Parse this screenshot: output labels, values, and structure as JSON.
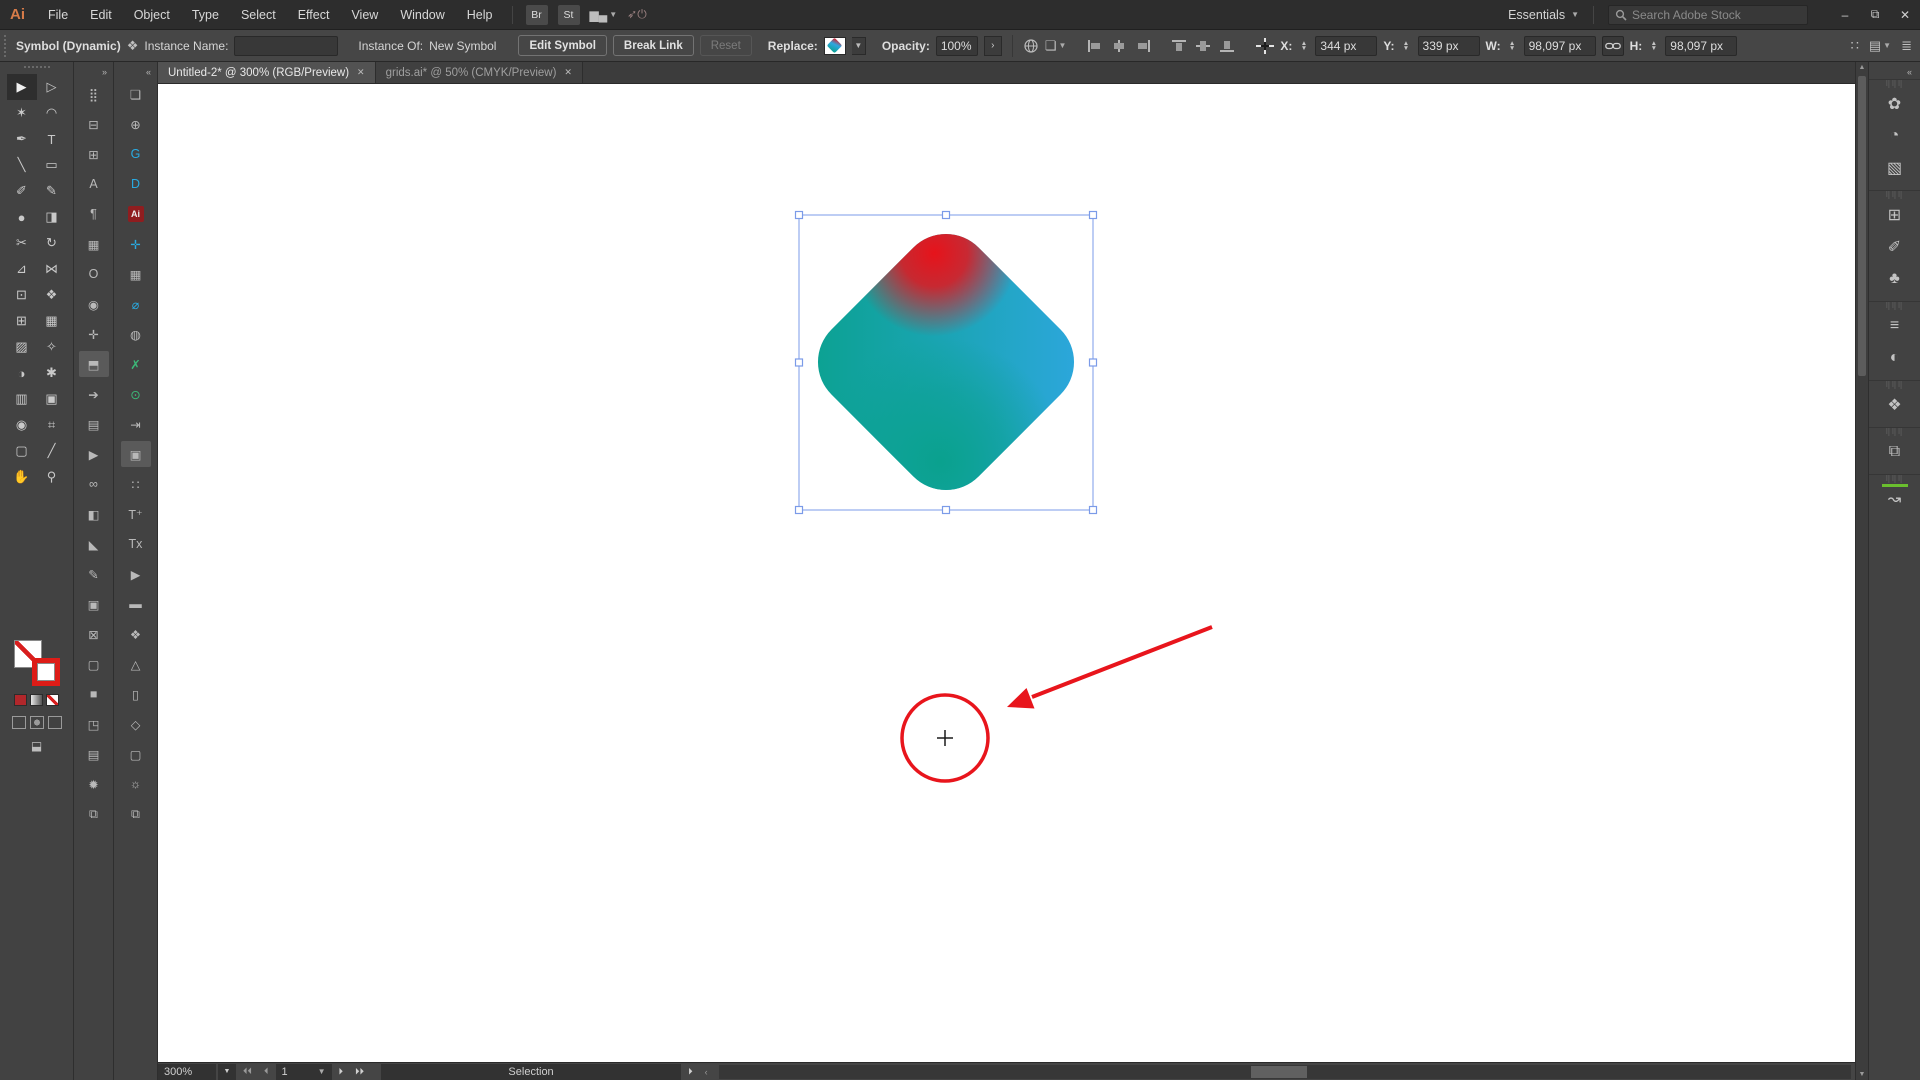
{
  "menubar": {
    "logo": "Ai",
    "menus": [
      "File",
      "Edit",
      "Object",
      "Type",
      "Select",
      "Effect",
      "View",
      "Window",
      "Help"
    ],
    "bridge_label": "Br",
    "stock_label": "St",
    "workspace_label": "Essentials",
    "search_placeholder": "Search Adobe Stock",
    "window_buttons": {
      "minimize": "–",
      "restore": "⧉",
      "close": "✕"
    }
  },
  "controlbar": {
    "context_label": "Symbol (Dynamic)",
    "instance_name_label": "Instance Name:",
    "instance_name_value": "",
    "instance_of_label": "Instance Of:",
    "instance_of_value": "New Symbol",
    "edit_symbol_label": "Edit Symbol",
    "break_link_label": "Break Link",
    "reset_label": "Reset",
    "replace_label": "Replace:",
    "opacity_label": "Opacity:",
    "opacity_value": "100%",
    "x_label": "X:",
    "x_value": "344 px",
    "y_label": "Y:",
    "y_value": "339 px",
    "w_label": "W:",
    "w_value": "98,097 px",
    "h_label": "H:",
    "h_value": "98,097 px"
  },
  "tabs": {
    "items": [
      {
        "title": "Untitled-2* @ 300% (RGB/Preview)",
        "close": "✕",
        "active": true
      },
      {
        "title": "grids.ai* @ 50% (CMYK/Preview)",
        "close": "✕",
        "active": false
      }
    ]
  },
  "toolbar": {
    "tools": [
      {
        "name": "selection-tool",
        "glyph": "▶",
        "selected": true
      },
      {
        "name": "direct-selection-tool",
        "glyph": "▷"
      },
      {
        "name": "magic-wand-tool",
        "glyph": "✶"
      },
      {
        "name": "lasso-tool",
        "glyph": "◠"
      },
      {
        "name": "pen-tool",
        "glyph": "✒"
      },
      {
        "name": "type-tool",
        "glyph": "T"
      },
      {
        "name": "line-segment-tool",
        "glyph": "╲"
      },
      {
        "name": "rectangle-tool",
        "glyph": "▭"
      },
      {
        "name": "paintbrush-tool",
        "glyph": "✐"
      },
      {
        "name": "pencil-tool",
        "glyph": "✎"
      },
      {
        "name": "blob-brush-tool",
        "glyph": "●"
      },
      {
        "name": "eraser-tool",
        "glyph": "◨"
      },
      {
        "name": "scissors-tool",
        "glyph": "✂"
      },
      {
        "name": "rotate-tool",
        "glyph": "↻"
      },
      {
        "name": "scale-tool",
        "glyph": "⊿"
      },
      {
        "name": "width-tool",
        "glyph": "⋈"
      },
      {
        "name": "free-transform-tool",
        "glyph": "⊡"
      },
      {
        "name": "shape-builder-tool",
        "glyph": "❖"
      },
      {
        "name": "perspective-grid-tool",
        "glyph": "⊞"
      },
      {
        "name": "mesh-tool",
        "glyph": "▦"
      },
      {
        "name": "gradient-tool",
        "glyph": "▨"
      },
      {
        "name": "eyedropper-tool",
        "glyph": "✧"
      },
      {
        "name": "blend-tool",
        "glyph": "◑"
      },
      {
        "name": "symbol-sprayer-tool",
        "glyph": "✱"
      },
      {
        "name": "column-graph-tool",
        "glyph": "▥"
      },
      {
        "name": "live-paint-bucket-tool",
        "glyph": "▣"
      },
      {
        "name": "live-paint-selection-tool",
        "glyph": "◉"
      },
      {
        "name": "rectangular-grid-tool",
        "glyph": "⌗"
      },
      {
        "name": "artboard-tool",
        "glyph": "▢"
      },
      {
        "name": "slice-tool",
        "glyph": "╱"
      },
      {
        "name": "hand-tool",
        "glyph": "✋"
      },
      {
        "name": "zoom-tool",
        "glyph": "⚲"
      }
    ]
  },
  "strip2": {
    "expand_label": "»",
    "items": [
      {
        "name": "panel-icon-grid",
        "glyph": "⣿"
      },
      {
        "name": "panel-icon-flatten",
        "glyph": "⊟"
      },
      {
        "name": "panel-icon-table",
        "glyph": "⊞"
      },
      {
        "name": "panel-icon-character",
        "glyph": "A"
      },
      {
        "name": "panel-icon-paragraph",
        "glyph": "¶"
      },
      {
        "name": "panel-icon-mesh",
        "glyph": "▦"
      },
      {
        "name": "panel-icon-opentype",
        "glyph": "O"
      },
      {
        "name": "panel-icon-target",
        "glyph": "◉"
      },
      {
        "name": "panel-icon-align",
        "glyph": "✛"
      },
      {
        "name": "panel-icon-shade",
        "glyph": "⬒",
        "pressed": true
      },
      {
        "name": "panel-icon-export",
        "glyph": "➔"
      },
      {
        "name": "panel-icon-rows",
        "glyph": "▤"
      },
      {
        "name": "panel-icon-play",
        "glyph": "▶"
      },
      {
        "name": "panel-icon-link",
        "glyph": "∞"
      },
      {
        "name": "panel-icon-half",
        "glyph": "◧"
      },
      {
        "name": "panel-icon-corner",
        "glyph": "◣"
      },
      {
        "name": "panel-icon-edit",
        "glyph": "✎"
      },
      {
        "name": "panel-icon-fill",
        "glyph": "▣"
      },
      {
        "name": "panel-icon-cross",
        "glyph": "⊠"
      },
      {
        "name": "panel-icon-frame",
        "glyph": "▢"
      },
      {
        "name": "panel-icon-solid",
        "glyph": "■"
      },
      {
        "name": "panel-icon-crop",
        "glyph": "◳"
      },
      {
        "name": "panel-icon-list",
        "glyph": "▤"
      },
      {
        "name": "panel-icon-flare",
        "glyph": "✹"
      },
      {
        "name": "panel-icon-stack",
        "glyph": "⧉"
      }
    ]
  },
  "strip3": {
    "collapse_label": "«",
    "items": [
      {
        "name": "panel-icon-folder",
        "glyph": "❏"
      },
      {
        "name": "panel-icon-add",
        "glyph": "⊕"
      },
      {
        "name": "panel-icon-g-script",
        "glyph": "G",
        "color": "#29abe2"
      },
      {
        "name": "panel-icon-d-script",
        "glyph": "D",
        "color": "#29abe2"
      },
      {
        "name": "panel-icon-ai-file",
        "glyph": "Ai",
        "tile": true
      },
      {
        "name": "panel-icon-align-cyan",
        "glyph": "✛",
        "color": "#29abe2"
      },
      {
        "name": "panel-icon-grid",
        "glyph": "▦"
      },
      {
        "name": "panel-icon-diameter",
        "glyph": "⌀",
        "color": "#29abe2"
      },
      {
        "name": "panel-icon-sphere",
        "glyph": "◍"
      },
      {
        "name": "panel-icon-check-green",
        "glyph": "✗",
        "color": "#3cb878"
      },
      {
        "name": "panel-icon-power-green",
        "glyph": "⊙",
        "color": "#3cb878"
      },
      {
        "name": "panel-icon-tab",
        "glyph": "⇥"
      },
      {
        "name": "panel-icon-board",
        "glyph": "▣",
        "pressed": true
      },
      {
        "name": "panel-icon-dots",
        "glyph": "∷"
      },
      {
        "name": "panel-icon-type-plus",
        "glyph": "T⁺"
      },
      {
        "name": "panel-icon-type-x",
        "glyph": "Tx"
      },
      {
        "name": "panel-icon-run",
        "glyph": "▶"
      },
      {
        "name": "panel-icon-bar",
        "glyph": "▬"
      },
      {
        "name": "panel-icon-diamond",
        "glyph": "❖"
      },
      {
        "name": "panel-icon-tri",
        "glyph": "△"
      },
      {
        "name": "panel-icon-page",
        "glyph": "▯"
      },
      {
        "name": "panel-icon-cube",
        "glyph": "◇"
      },
      {
        "name": "panel-icon-sheet",
        "glyph": "▢"
      },
      {
        "name": "panel-icon-sun",
        "glyph": "☼"
      },
      {
        "name": "panel-icon-copy",
        "glyph": "⧉"
      }
    ]
  },
  "right_strip": {
    "collapse_label": "«",
    "groups": [
      {
        "items": [
          {
            "name": "color-panel-icon",
            "glyph": "✿"
          },
          {
            "name": "color-guide-panel-icon",
            "glyph": "◔"
          },
          {
            "name": "gradient-panel-icon",
            "glyph": "▧"
          }
        ]
      },
      {
        "items": [
          {
            "name": "swatches-panel-icon",
            "glyph": "⊞"
          },
          {
            "name": "brushes-panel-icon",
            "glyph": "✐"
          },
          {
            "name": "symbols-panel-icon",
            "glyph": "♣"
          }
        ]
      },
      {
        "items": [
          {
            "name": "stroke-panel-icon",
            "glyph": "≡"
          },
          {
            "name": "transparency-panel-icon",
            "glyph": "◐"
          }
        ]
      },
      {
        "items": [
          {
            "name": "layers-panel-icon",
            "glyph": "❖"
          }
        ]
      },
      {
        "items": [
          {
            "name": "artboards-panel-icon",
            "glyph": "⧉"
          }
        ]
      },
      {
        "items": [
          {
            "name": "simplify-path-panel-icon",
            "glyph": "↝",
            "greenbar": true
          }
        ]
      }
    ]
  },
  "statusbar": {
    "zoom_value": "300%",
    "page_value": "1",
    "first_label": "⏴⏴",
    "prev_label": "⏴",
    "next_label": "⏵",
    "last_label": "⏵⏵",
    "status_text": "Selection",
    "flyout_label": "⏵",
    "collapse_label": "‹"
  },
  "canvas": {
    "shape": {
      "blue": "#2EA7E0",
      "mid": "#18A4AE",
      "teal": "#0AA18E",
      "red": "#E6131B",
      "selection_blue": "#7B9BE8"
    },
    "annotation": {
      "color": "#E8151C",
      "crosshair": "+"
    }
  }
}
